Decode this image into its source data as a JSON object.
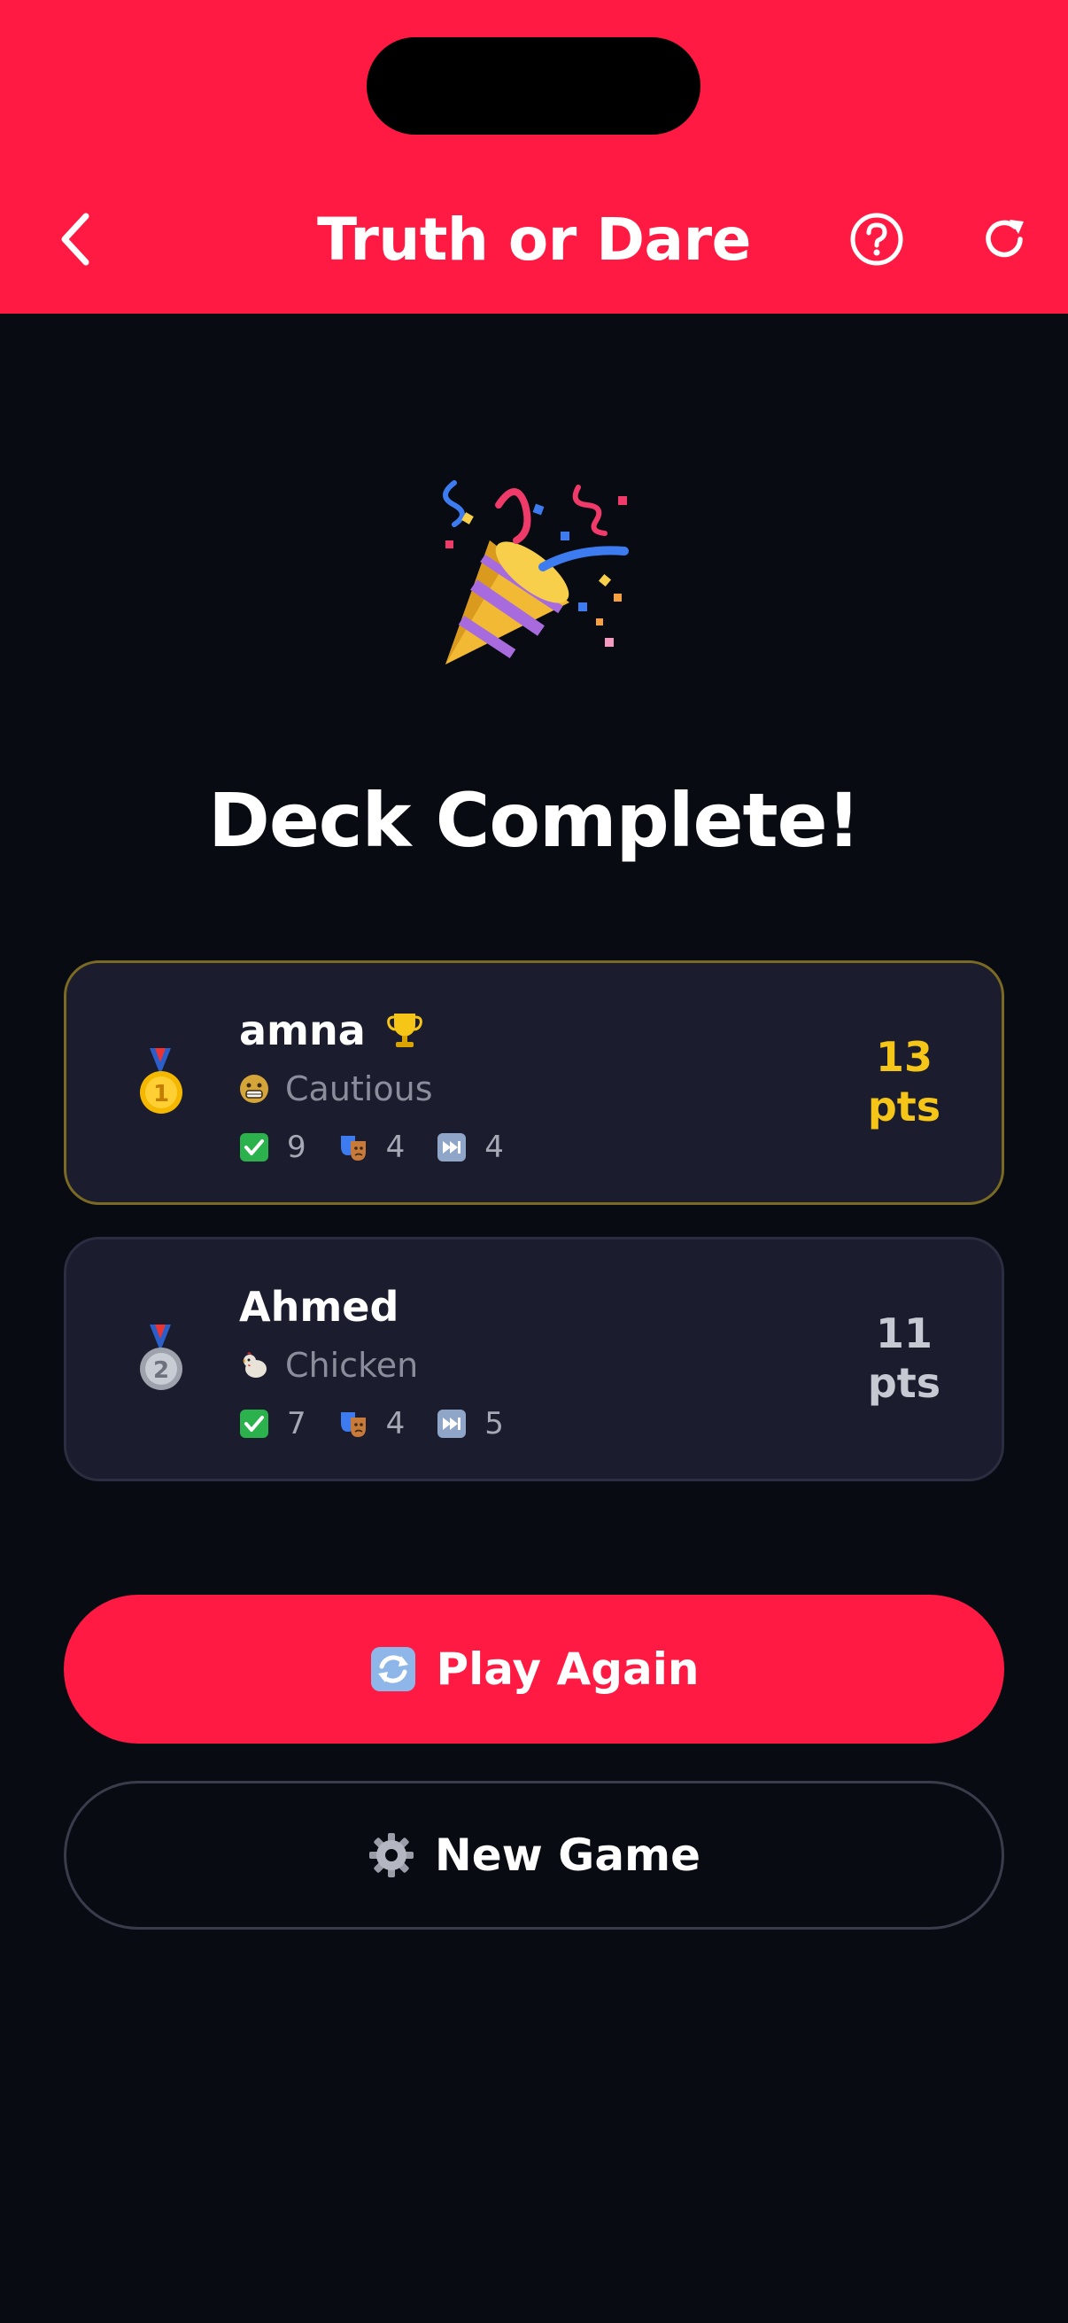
{
  "header": {
    "title": "Truth or Dare",
    "back_icon": "chevron-left-icon",
    "help_icon": "question-circle-icon",
    "refresh_icon": "refresh-icon",
    "background": "#ff1a44"
  },
  "main": {
    "celebration_icon": "party-popper-icon",
    "headline": "Deck Complete!"
  },
  "players": [
    {
      "rank_icon": "gold-medal-icon",
      "name": "amna",
      "trophy_icon": "trophy-icon",
      "tag_emoji": "grimacing-face-icon",
      "tag": "Cautious",
      "truths_icon": "check-mark-icon",
      "truths": "9",
      "dares_icon": "performing-arts-icon",
      "dares": "4",
      "skips_icon": "fast-forward-icon",
      "skips": "4",
      "score": "13",
      "score_unit": "pts",
      "score_color": "#f5c518"
    },
    {
      "rank_icon": "silver-medal-icon",
      "name": "Ahmed",
      "tag_emoji": "chicken-icon",
      "tag": "Chicken",
      "truths_icon": "check-mark-icon",
      "truths": "7",
      "dares_icon": "performing-arts-icon",
      "dares": "4",
      "skips_icon": "fast-forward-icon",
      "skips": "5",
      "score": "11",
      "score_unit": "pts",
      "score_color": "#c6c8d2"
    }
  ],
  "actions": {
    "play_again_label": "Play Again",
    "play_again_icon": "counterclockwise-arrows-icon",
    "new_game_label": "New Game",
    "new_game_icon": "gear-icon"
  },
  "colors": {
    "accent": "#ff1a44",
    "background": "#090b13",
    "card": "#1b1c2d",
    "gold": "#f5c518"
  }
}
